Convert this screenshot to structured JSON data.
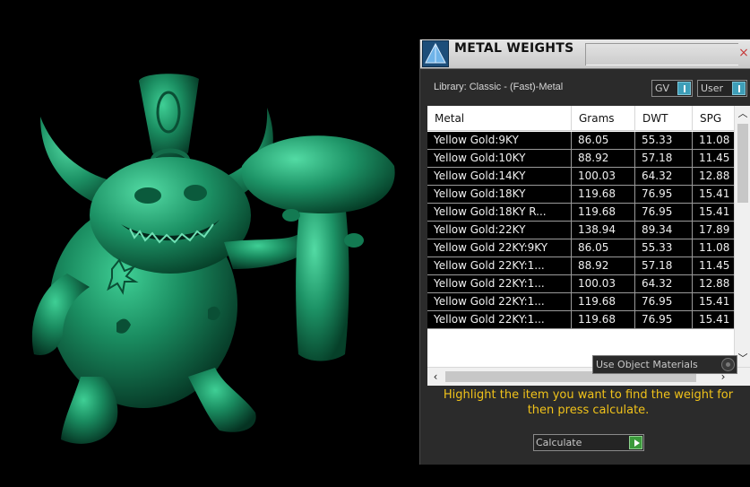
{
  "panel": {
    "title": "METAL WEIGHTS",
    "close_glyph": "×",
    "library_label": "Library: Classic - (Fast)-Metal",
    "gv_toggle": "GV",
    "user_toggle": "User",
    "use_object_materials": "Use Object Materials",
    "instructions": "Highlight the item you want to find the weight for then press calculate.",
    "calculate_label": "Calculate"
  },
  "table": {
    "columns": [
      "Metal",
      "Grams",
      "DWT",
      "SPG"
    ],
    "rows": [
      [
        "Yellow Gold:9KY",
        "86.05",
        "55.33",
        "11.08"
      ],
      [
        "Yellow Gold:10KY",
        "88.92",
        "57.18",
        "11.45"
      ],
      [
        "Yellow Gold:14KY",
        "100.03",
        "64.32",
        "12.88"
      ],
      [
        "Yellow Gold:18KY",
        "119.68",
        "76.95",
        "15.41"
      ],
      [
        "Yellow Gold:18KY R...",
        "119.68",
        "76.95",
        "15.41"
      ],
      [
        "Yellow Gold:22KY",
        "138.94",
        "89.34",
        "17.89"
      ],
      [
        "Yellow Gold 22KY:9KY",
        "86.05",
        "55.33",
        "11.08"
      ],
      [
        "Yellow Gold 22KY:1...",
        "88.92",
        "57.18",
        "11.45"
      ],
      [
        "Yellow Gold 22KY:1...",
        "100.03",
        "64.32",
        "12.88"
      ],
      [
        "Yellow Gold 22KY:1...",
        "119.68",
        "76.95",
        "15.41"
      ],
      [
        "Yellow Gold 22KY:1...",
        "119.68",
        "76.95",
        "15.41"
      ]
    ]
  },
  "icons": {
    "app": "metal-weights-pyramid-icon",
    "close": "close-icon",
    "scroll_up": "scroll-up-arrow",
    "scroll_down": "scroll-down-arrow",
    "scroll_left": "scroll-left-arrow",
    "scroll_right": "scroll-right-arrow"
  },
  "colors": {
    "model_green": "#1f8a5f",
    "instruction_yellow": "#f0c21a",
    "toggle_teal": "#3e9eb8",
    "calculate_green": "#3b9a3b"
  }
}
